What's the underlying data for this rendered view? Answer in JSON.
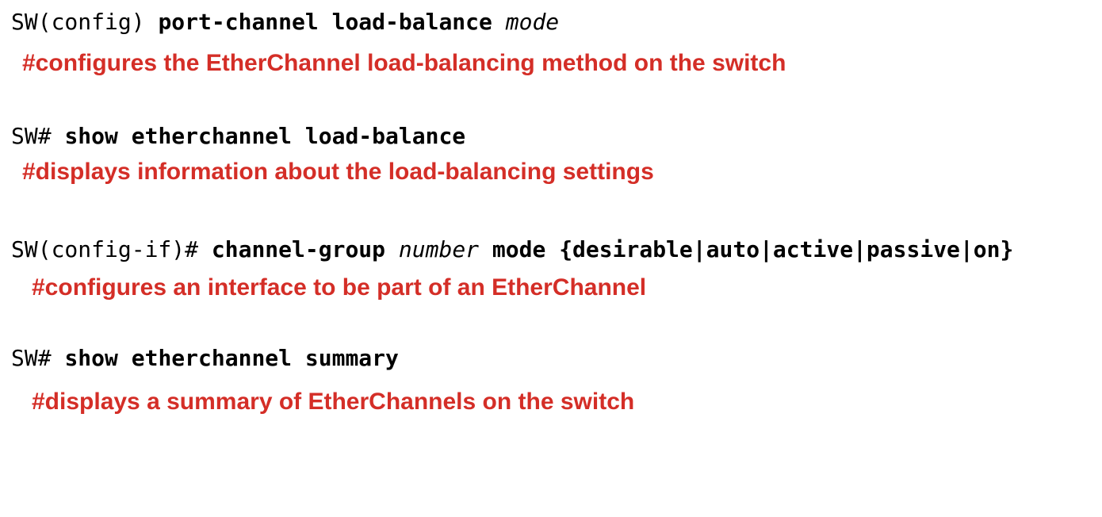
{
  "colors": {
    "command_text": "#000000",
    "note_text": "#d42e27",
    "background": "#ffffff"
  },
  "entries": [
    {
      "prompt": "SW(config) ",
      "keyword": "port-channel load-balance ",
      "argument": "mode",
      "keyword_tail": "",
      "note": "#configures the EtherChannel load-balancing method on the switch"
    },
    {
      "prompt": "SW# ",
      "keyword": "show etherchannel load-balance",
      "argument": "",
      "keyword_tail": "",
      "note": "#displays information about the load-balancing settings"
    },
    {
      "prompt": "SW(config-if)# ",
      "keyword": "channel-group ",
      "argument": "number",
      "keyword_tail": " mode {desirable|auto|active|passive|on}",
      "note": "#configures an interface to be part of an EtherChannel"
    },
    {
      "prompt": "SW# ",
      "keyword": "show etherchannel summary",
      "argument": "",
      "keyword_tail": "",
      "note": "#displays a summary of EtherChannels on the switch"
    }
  ]
}
